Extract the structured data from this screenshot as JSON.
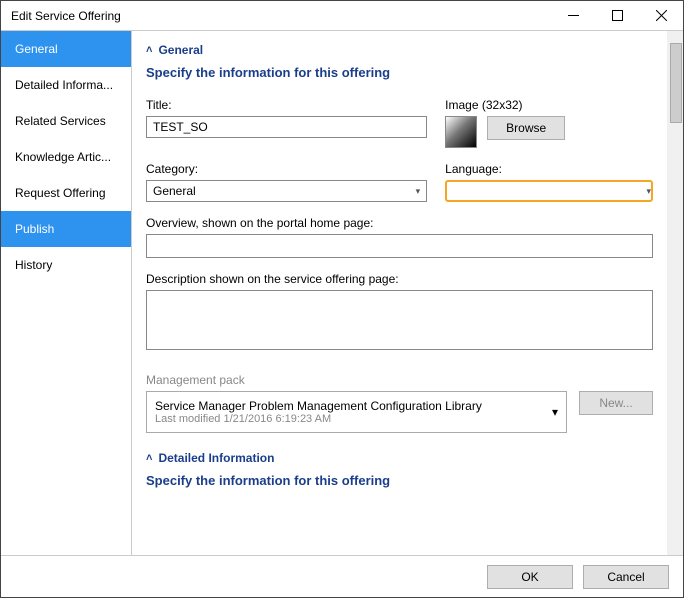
{
  "window": {
    "title": "Edit Service Offering"
  },
  "sidebar": {
    "items": [
      {
        "label": "General",
        "selected": true
      },
      {
        "label": "Detailed Informa...",
        "selected": false
      },
      {
        "label": "Related Services",
        "selected": false
      },
      {
        "label": "Knowledge Artic...",
        "selected": false
      },
      {
        "label": "Request Offering",
        "selected": false
      },
      {
        "label": "Publish",
        "selected": true
      },
      {
        "label": "History",
        "selected": false
      }
    ]
  },
  "main": {
    "general": {
      "heading": "General",
      "subheading": "Specify the information for this offering",
      "title_label": "Title:",
      "title_value": "TEST_SO",
      "image_label": "Image (32x32)",
      "browse": "Browse",
      "category_label": "Category:",
      "category_value": "General",
      "language_label": "Language:",
      "language_value": "",
      "overview_label": "Overview, shown on the portal home page:",
      "overview_value": "",
      "description_label": "Description shown on the service offering page:",
      "description_value": "",
      "mgmt_label": "Management pack",
      "mgmt_name": "Service Manager Problem Management Configuration Library",
      "mgmt_modified": "Last modified  1/21/2016 6:19:23 AM",
      "new_btn": "New..."
    },
    "detailed": {
      "heading": "Detailed Information",
      "subheading": "Specify the information for this offering"
    }
  },
  "footer": {
    "ok": "OK",
    "cancel": "Cancel"
  }
}
